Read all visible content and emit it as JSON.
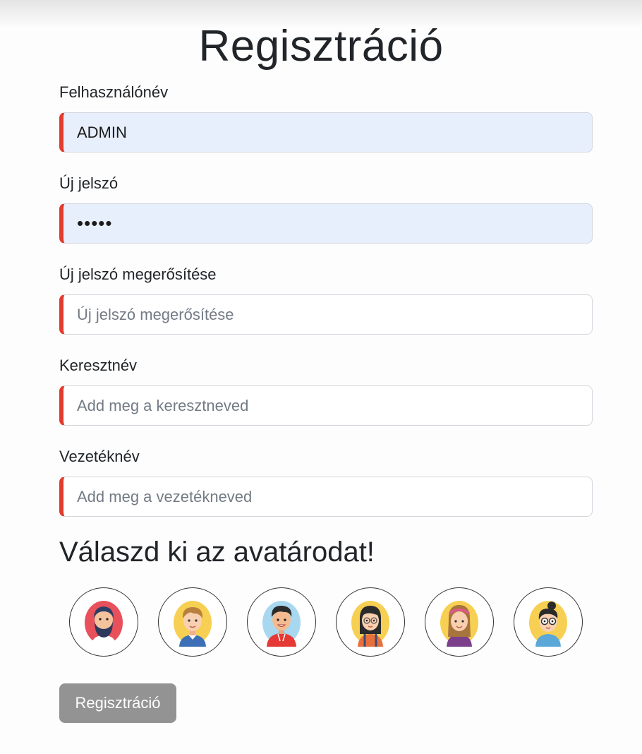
{
  "title": "Regisztráció",
  "form": {
    "username": {
      "label": "Felhasználónév",
      "value": "ADMIN",
      "placeholder": ""
    },
    "password": {
      "label": "Új jelszó",
      "value": "•••••",
      "placeholder": ""
    },
    "confirm": {
      "label": "Új jelszó megerősítése",
      "value": "",
      "placeholder": "Új jelszó megerősítése"
    },
    "firstname": {
      "label": "Keresztnév",
      "value": "",
      "placeholder": "Add meg a keresztneved"
    },
    "lastname": {
      "label": "Vezetéknév",
      "value": "",
      "placeholder": "Add meg a vezetékneved"
    }
  },
  "avatar_section": {
    "heading": "Válaszd ki az avatárodat!",
    "avatars": [
      "bearded-man-avatar",
      "blond-boy-avatar",
      "dark-haired-boy-avatar",
      "girl-with-glasses-avatar",
      "girl-with-headband-avatar",
      "woman-with-glasses-avatar"
    ]
  },
  "submit_label": "Regisztráció",
  "colors": {
    "invalid_border": "#e33b2e",
    "autofill_bg": "#e8effc",
    "button_disabled": "#939393",
    "text": "#212529"
  }
}
